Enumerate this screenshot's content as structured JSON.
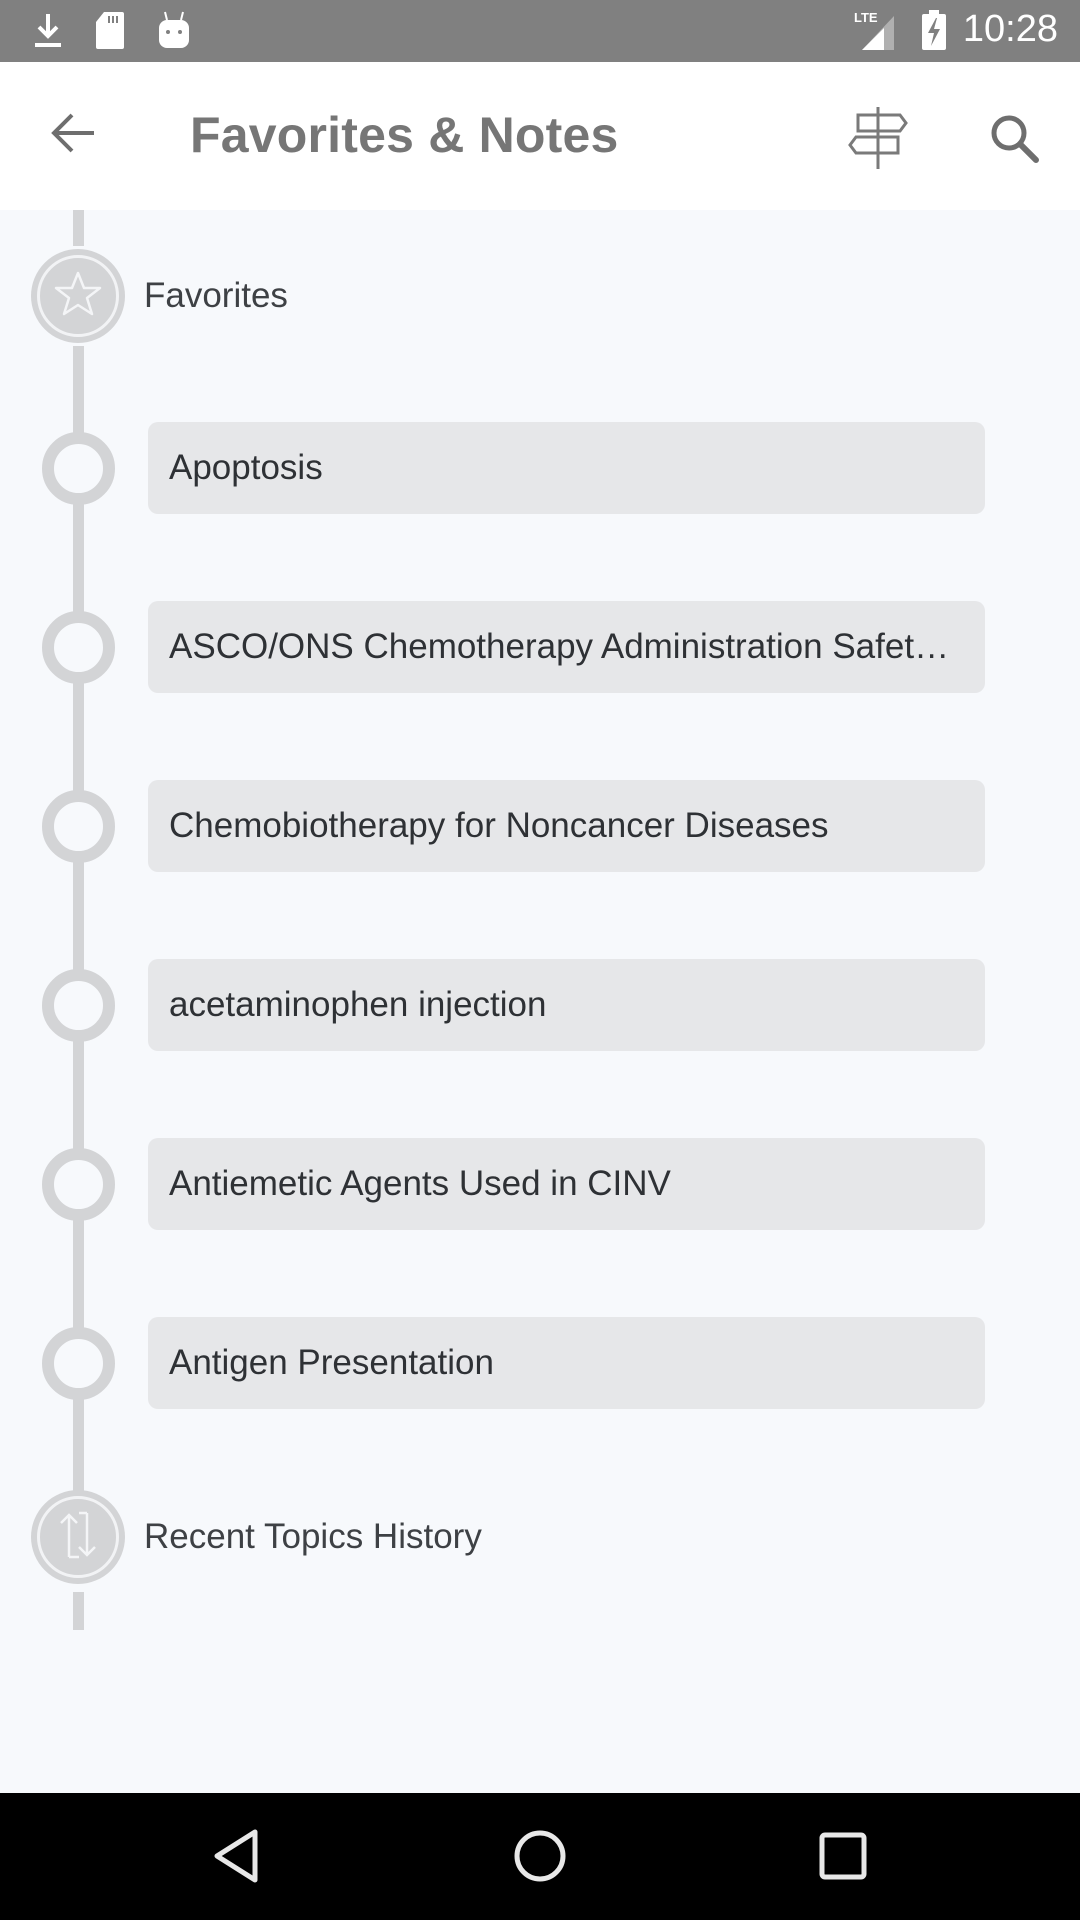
{
  "status_bar": {
    "left_icons": [
      "download-icon",
      "sd-card-icon",
      "android-icon"
    ],
    "network": "LTE",
    "right_icons": [
      "lte-signal-icon",
      "battery-charging-icon"
    ],
    "time": "10:28"
  },
  "app_bar": {
    "back_icon": "arrow-back-icon",
    "title": "Favorites & Notes",
    "actions": [
      {
        "name": "signpost-icon",
        "label": "Navigate"
      },
      {
        "name": "search-icon",
        "label": "Search"
      }
    ]
  },
  "timeline": {
    "favorites_section": {
      "label": "Favorites",
      "icon": "star-icon"
    },
    "favorites": [
      {
        "label": "Apoptosis"
      },
      {
        "label": "ASCO/ONS Chemotherapy Administration Safety Standards"
      },
      {
        "label": "Chemobiotherapy for Noncancer Diseases"
      },
      {
        "label": "acetaminophen injection"
      },
      {
        "label": "Antiemetic Agents Used in CINV"
      },
      {
        "label": "Antigen Presentation"
      }
    ],
    "history_section": {
      "label": "Recent Topics History",
      "icon": "swap-vertical-icon"
    }
  },
  "nav_bar": {
    "buttons": [
      "back-triangle-icon",
      "home-circle-icon",
      "recents-square-icon"
    ]
  },
  "colors": {
    "status_bar": "#808080",
    "app_bar": "#ffffff",
    "background": "#f7f9fc",
    "timeline": "#d3d4d6",
    "card": "#e6e7e9",
    "title_text": "#767676",
    "body_text": "#2e3135",
    "nav_bar": "#000000"
  }
}
